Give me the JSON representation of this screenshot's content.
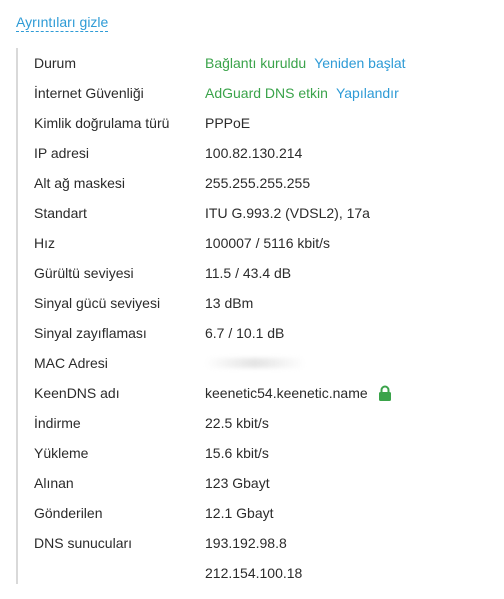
{
  "toggle_label": "Ayrıntıları gizle",
  "rows": [
    {
      "label": "Durum",
      "value": "Bağlantı kuruldu",
      "action": "Yeniden başlat"
    },
    {
      "label": "İnternet Güvenliği",
      "value": "AdGuard DNS etkin",
      "action": "Yapılandır"
    },
    {
      "label": "Kimlik doğrulama türü",
      "value": "PPPoE"
    },
    {
      "label": "IP adresi",
      "value": "100.82.130.214"
    },
    {
      "label": "Alt ağ maskesi",
      "value": "255.255.255.255"
    },
    {
      "label": "Standart",
      "value": "ITU G.993.2 (VDSL2), 17a"
    },
    {
      "label": "Hız",
      "value": "100007 / 5116 kbit/s"
    },
    {
      "label": "Gürültü seviyesi",
      "value": "11.5 / 43.4 dB"
    },
    {
      "label": "Sinyal gücü seviyesi",
      "value": "13 dBm"
    },
    {
      "label": "Sinyal zayıflaması",
      "value": "6.7 / 10.1 dB"
    },
    {
      "label": "MAC Adresi",
      "value": ""
    },
    {
      "label": "KeenDNS adı",
      "value": "keenetic54.keenetic.name"
    },
    {
      "label": "İndirme",
      "value": "22.5 kbit/s"
    },
    {
      "label": "Yükleme",
      "value": "15.6 kbit/s"
    },
    {
      "label": "Alınan",
      "value": "123 Gbayt"
    },
    {
      "label": "Gönderilen",
      "value": "12.1 Gbayt"
    },
    {
      "label": "DNS sunucuları",
      "value": "193.192.98.8"
    },
    {
      "label": "",
      "value": "212.154.100.18"
    }
  ],
  "colors": {
    "status_green": "#3aa34a",
    "link_blue": "#2e9bd6",
    "lock_green": "#3aa34a"
  },
  "icons": {
    "keendns": "lock-icon"
  }
}
